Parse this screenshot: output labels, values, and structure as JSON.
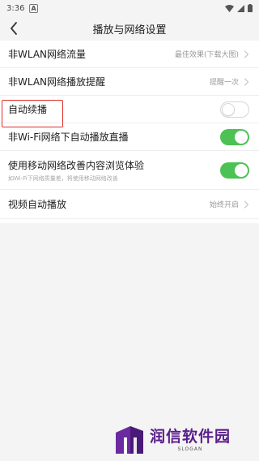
{
  "status_bar": {
    "time": "3:36",
    "a_badge": "A",
    "icons": [
      "wifi-icon",
      "signal-icon",
      "battery-icon"
    ]
  },
  "nav": {
    "title": "播放与网络设置",
    "back_icon": "chevron-left-icon"
  },
  "rows": [
    {
      "label": "非WLAN网络流量",
      "value": "最佳效果(下载大图)"
    },
    {
      "label": "非WLAN网络播放提醒",
      "value": "提醒一次"
    },
    {
      "label": "自动续播",
      "toggle": false
    },
    {
      "label": "非Wi-Fi网络下自动播放直播",
      "toggle": true
    },
    {
      "label": "使用移动网络改善内容浏览体验",
      "sub": "如Wi-Fi下网络质量差，将使用移动网络改善",
      "toggle": true
    },
    {
      "label": "视频自动播放",
      "value": "始终开启"
    }
  ],
  "colors": {
    "toggle_on": "#4cc254",
    "highlight": "#e0302c",
    "background_gray": "#f4f4f4",
    "watermark_purple": "#5a1f8a"
  },
  "watermark": {
    "name": "润信软件园",
    "slogan": "SLOGAN"
  }
}
